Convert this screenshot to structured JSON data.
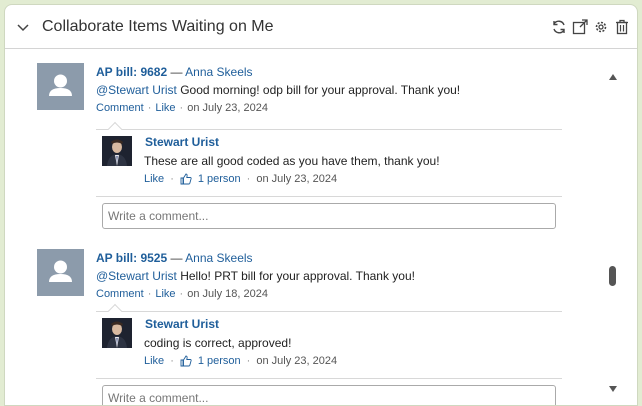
{
  "panel": {
    "title": "Collaborate Items Waiting on Me",
    "header_icons": [
      "refresh-icon",
      "popout-icon",
      "gear-icon",
      "trash-icon"
    ]
  },
  "posts": [
    {
      "item_link": "AP bill: 9682",
      "dash": "—",
      "author": "Anna Skeels",
      "mention": "@Stewart Urist",
      "message": "Good morning! odp bill for your approval. Thank you!",
      "comment_label": "Comment",
      "like_label": "Like",
      "date": "on July 23, 2024",
      "reply": {
        "name": "Stewart Urist",
        "text": "These are all good coded as you have them, thank you!",
        "like_label": "Like",
        "likes": "1 person",
        "date": "on July 23, 2024"
      },
      "comment_placeholder": "Write a comment..."
    },
    {
      "item_link": "AP bill: 9525",
      "dash": "—",
      "author": "Anna Skeels",
      "mention": "@Stewart Urist",
      "message": "Hello! PRT bill for your approval. Thank you!",
      "comment_label": "Comment",
      "like_label": "Like",
      "date": "on July 18, 2024",
      "reply": {
        "name": "Stewart Urist",
        "text": "coding is correct, approved!",
        "like_label": "Like",
        "likes": "1 person",
        "date": "on July 23, 2024"
      },
      "comment_placeholder": "Write a comment..."
    }
  ],
  "colors": {
    "link": "#1f5e9a",
    "avatar_bg": "#8c9bab",
    "page_bg": "#e2ecd2"
  }
}
